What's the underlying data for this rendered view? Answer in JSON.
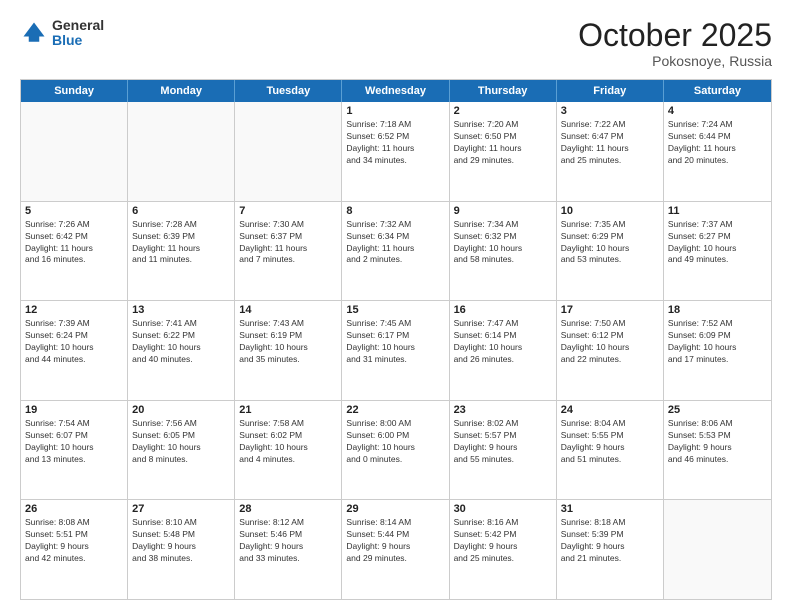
{
  "header": {
    "logo": {
      "general": "General",
      "blue": "Blue"
    },
    "title": "October 2025",
    "location": "Pokosnoye, Russia"
  },
  "calendar": {
    "days": [
      "Sunday",
      "Monday",
      "Tuesday",
      "Wednesday",
      "Thursday",
      "Friday",
      "Saturday"
    ],
    "rows": [
      [
        {
          "day": "",
          "text": ""
        },
        {
          "day": "",
          "text": ""
        },
        {
          "day": "",
          "text": ""
        },
        {
          "day": "1",
          "text": "Sunrise: 7:18 AM\nSunset: 6:52 PM\nDaylight: 11 hours\nand 34 minutes."
        },
        {
          "day": "2",
          "text": "Sunrise: 7:20 AM\nSunset: 6:50 PM\nDaylight: 11 hours\nand 29 minutes."
        },
        {
          "day": "3",
          "text": "Sunrise: 7:22 AM\nSunset: 6:47 PM\nDaylight: 11 hours\nand 25 minutes."
        },
        {
          "day": "4",
          "text": "Sunrise: 7:24 AM\nSunset: 6:44 PM\nDaylight: 11 hours\nand 20 minutes."
        }
      ],
      [
        {
          "day": "5",
          "text": "Sunrise: 7:26 AM\nSunset: 6:42 PM\nDaylight: 11 hours\nand 16 minutes."
        },
        {
          "day": "6",
          "text": "Sunrise: 7:28 AM\nSunset: 6:39 PM\nDaylight: 11 hours\nand 11 minutes."
        },
        {
          "day": "7",
          "text": "Sunrise: 7:30 AM\nSunset: 6:37 PM\nDaylight: 11 hours\nand 7 minutes."
        },
        {
          "day": "8",
          "text": "Sunrise: 7:32 AM\nSunset: 6:34 PM\nDaylight: 11 hours\nand 2 minutes."
        },
        {
          "day": "9",
          "text": "Sunrise: 7:34 AM\nSunset: 6:32 PM\nDaylight: 10 hours\nand 58 minutes."
        },
        {
          "day": "10",
          "text": "Sunrise: 7:35 AM\nSunset: 6:29 PM\nDaylight: 10 hours\nand 53 minutes."
        },
        {
          "day": "11",
          "text": "Sunrise: 7:37 AM\nSunset: 6:27 PM\nDaylight: 10 hours\nand 49 minutes."
        }
      ],
      [
        {
          "day": "12",
          "text": "Sunrise: 7:39 AM\nSunset: 6:24 PM\nDaylight: 10 hours\nand 44 minutes."
        },
        {
          "day": "13",
          "text": "Sunrise: 7:41 AM\nSunset: 6:22 PM\nDaylight: 10 hours\nand 40 minutes."
        },
        {
          "day": "14",
          "text": "Sunrise: 7:43 AM\nSunset: 6:19 PM\nDaylight: 10 hours\nand 35 minutes."
        },
        {
          "day": "15",
          "text": "Sunrise: 7:45 AM\nSunset: 6:17 PM\nDaylight: 10 hours\nand 31 minutes."
        },
        {
          "day": "16",
          "text": "Sunrise: 7:47 AM\nSunset: 6:14 PM\nDaylight: 10 hours\nand 26 minutes."
        },
        {
          "day": "17",
          "text": "Sunrise: 7:50 AM\nSunset: 6:12 PM\nDaylight: 10 hours\nand 22 minutes."
        },
        {
          "day": "18",
          "text": "Sunrise: 7:52 AM\nSunset: 6:09 PM\nDaylight: 10 hours\nand 17 minutes."
        }
      ],
      [
        {
          "day": "19",
          "text": "Sunrise: 7:54 AM\nSunset: 6:07 PM\nDaylight: 10 hours\nand 13 minutes."
        },
        {
          "day": "20",
          "text": "Sunrise: 7:56 AM\nSunset: 6:05 PM\nDaylight: 10 hours\nand 8 minutes."
        },
        {
          "day": "21",
          "text": "Sunrise: 7:58 AM\nSunset: 6:02 PM\nDaylight: 10 hours\nand 4 minutes."
        },
        {
          "day": "22",
          "text": "Sunrise: 8:00 AM\nSunset: 6:00 PM\nDaylight: 10 hours\nand 0 minutes."
        },
        {
          "day": "23",
          "text": "Sunrise: 8:02 AM\nSunset: 5:57 PM\nDaylight: 9 hours\nand 55 minutes."
        },
        {
          "day": "24",
          "text": "Sunrise: 8:04 AM\nSunset: 5:55 PM\nDaylight: 9 hours\nand 51 minutes."
        },
        {
          "day": "25",
          "text": "Sunrise: 8:06 AM\nSunset: 5:53 PM\nDaylight: 9 hours\nand 46 minutes."
        }
      ],
      [
        {
          "day": "26",
          "text": "Sunrise: 8:08 AM\nSunset: 5:51 PM\nDaylight: 9 hours\nand 42 minutes."
        },
        {
          "day": "27",
          "text": "Sunrise: 8:10 AM\nSunset: 5:48 PM\nDaylight: 9 hours\nand 38 minutes."
        },
        {
          "day": "28",
          "text": "Sunrise: 8:12 AM\nSunset: 5:46 PM\nDaylight: 9 hours\nand 33 minutes."
        },
        {
          "day": "29",
          "text": "Sunrise: 8:14 AM\nSunset: 5:44 PM\nDaylight: 9 hours\nand 29 minutes."
        },
        {
          "day": "30",
          "text": "Sunrise: 8:16 AM\nSunset: 5:42 PM\nDaylight: 9 hours\nand 25 minutes."
        },
        {
          "day": "31",
          "text": "Sunrise: 8:18 AM\nSunset: 5:39 PM\nDaylight: 9 hours\nand 21 minutes."
        },
        {
          "day": "",
          "text": ""
        }
      ]
    ]
  }
}
